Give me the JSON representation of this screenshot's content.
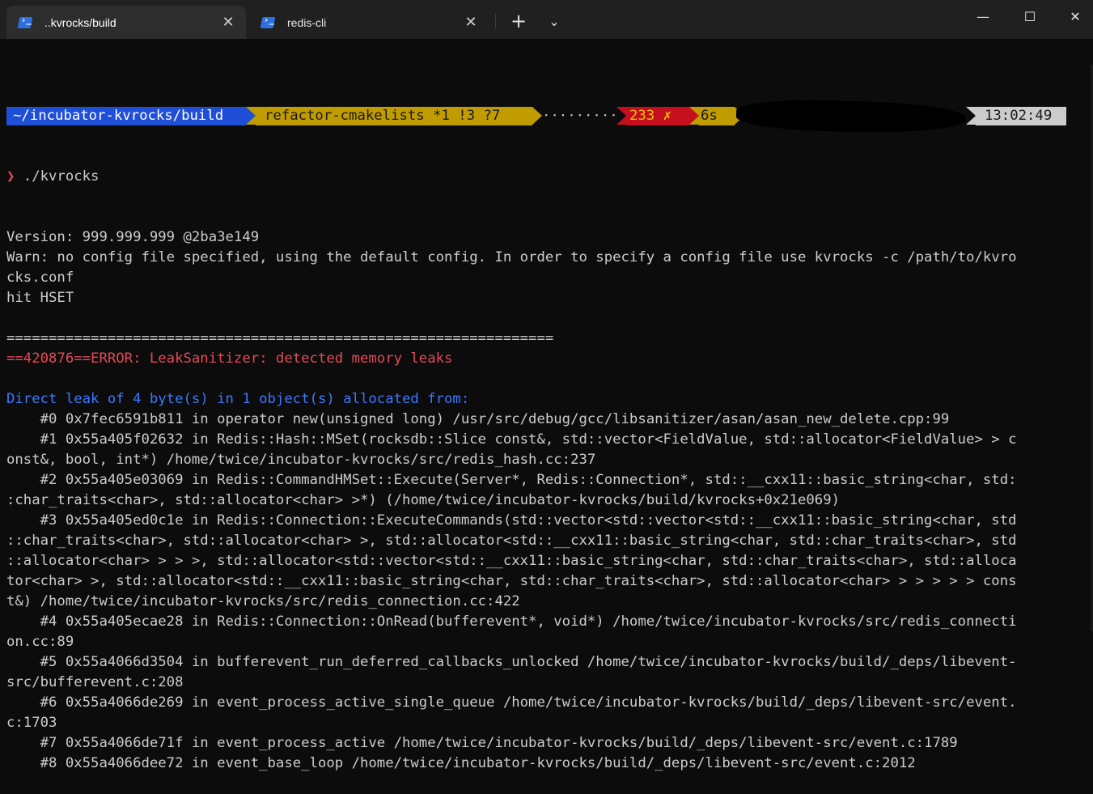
{
  "tabs": [
    {
      "title": "..kvrocks/build",
      "active": true,
      "icon": "powershell-icon"
    },
    {
      "title": "redis-cli",
      "active": false,
      "icon": "powershell-icon"
    }
  ],
  "titlebar": {
    "new_tab_glyph": "+",
    "dropdown_glyph": "⌄",
    "close_tab_glyph": "✕",
    "minimize_glyph": "—",
    "maximize_glyph": "☐",
    "close_glyph": "✕"
  },
  "prompt": {
    "path": "~/incubator-kvrocks/build",
    "git": "refactor-cmakelists *1 !3 ?7",
    "dots": "··········",
    "exit_status": "233 ✗",
    "duration": "6s",
    "clock": "13:02:49",
    "chevron": "❯",
    "command": " ./kvrocks"
  },
  "colors": {
    "background": "#0c0c0c",
    "text": "#cccccc",
    "error_red": "#e74856",
    "info_blue": "#3b78ff",
    "path_segment": "#1f4fd6",
    "git_segment": "#c19c00",
    "status_segment": "#c50f1f"
  },
  "output": [
    {
      "text": "Version: 999.999.999 @2ba3e149",
      "style": ""
    },
    {
      "text": "Warn: no config file specified, using the default config. In order to specify a config file use kvrocks -c /path/to/kvro",
      "style": ""
    },
    {
      "text": "cks.conf",
      "style": ""
    },
    {
      "text": "hit HSET",
      "style": ""
    },
    {
      "text": "",
      "style": ""
    },
    {
      "text": "=================================================================",
      "style": ""
    },
    {
      "text": "==420876==ERROR: LeakSanitizer: detected memory leaks",
      "style": "red"
    },
    {
      "text": "",
      "style": ""
    },
    {
      "text": "Direct leak of 4 byte(s) in 1 object(s) allocated from:",
      "style": "blue"
    },
    {
      "text": "    #0 0x7fec6591b811 in operator new(unsigned long) /usr/src/debug/gcc/libsanitizer/asan/asan_new_delete.cpp:99",
      "style": ""
    },
    {
      "text": "    #1 0x55a405f02632 in Redis::Hash::MSet(rocksdb::Slice const&, std::vector<FieldValue, std::allocator<FieldValue> > c",
      "style": ""
    },
    {
      "text": "onst&, bool, int*) /home/twice/incubator-kvrocks/src/redis_hash.cc:237",
      "style": ""
    },
    {
      "text": "    #2 0x55a405e03069 in Redis::CommandHMSet::Execute(Server*, Redis::Connection*, std::__cxx11::basic_string<char, std:",
      "style": ""
    },
    {
      "text": ":char_traits<char>, std::allocator<char> >*) (/home/twice/incubator-kvrocks/build/kvrocks+0x21e069)",
      "style": ""
    },
    {
      "text": "    #3 0x55a405ed0c1e in Redis::Connection::ExecuteCommands(std::vector<std::vector<std::__cxx11::basic_string<char, std",
      "style": ""
    },
    {
      "text": "::char_traits<char>, std::allocator<char> >, std::allocator<std::__cxx11::basic_string<char, std::char_traits<char>, std",
      "style": ""
    },
    {
      "text": "::allocator<char> > > >, std::allocator<std::vector<std::__cxx11::basic_string<char, std::char_traits<char>, std::alloca",
      "style": ""
    },
    {
      "text": "tor<char> >, std::allocator<std::__cxx11::basic_string<char, std::char_traits<char>, std::allocator<char> > > > > > cons",
      "style": ""
    },
    {
      "text": "t&) /home/twice/incubator-kvrocks/src/redis_connection.cc:422",
      "style": ""
    },
    {
      "text": "    #4 0x55a405ecae28 in Redis::Connection::OnRead(bufferevent*, void*) /home/twice/incubator-kvrocks/src/redis_connecti",
      "style": ""
    },
    {
      "text": "on.cc:89",
      "style": ""
    },
    {
      "text": "    #5 0x55a4066d3504 in bufferevent_run_deferred_callbacks_unlocked /home/twice/incubator-kvrocks/build/_deps/libevent-",
      "style": ""
    },
    {
      "text": "src/bufferevent.c:208",
      "style": ""
    },
    {
      "text": "    #6 0x55a4066de269 in event_process_active_single_queue /home/twice/incubator-kvrocks/build/_deps/libevent-src/event.",
      "style": ""
    },
    {
      "text": "c:1703",
      "style": ""
    },
    {
      "text": "    #7 0x55a4066de71f in event_process_active /home/twice/incubator-kvrocks/build/_deps/libevent-src/event.c:1789",
      "style": ""
    },
    {
      "text": "    #8 0x55a4066dee72 in event_base_loop /home/twice/incubator-kvrocks/build/_deps/libevent-src/event.c:2012",
      "style": ""
    }
  ]
}
